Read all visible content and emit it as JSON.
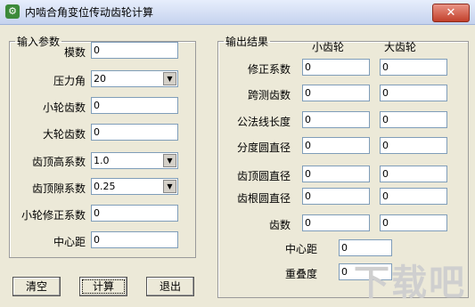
{
  "window": {
    "title": "内啮合角变位传动齿轮计算",
    "close": "✕"
  },
  "input": {
    "legend": "输入参数",
    "rows": [
      {
        "label": "模数",
        "value": "0"
      },
      {
        "label": "压力角",
        "value": "20"
      },
      {
        "label": "小轮齿数",
        "value": "0"
      },
      {
        "label": "大轮齿数",
        "value": "0"
      },
      {
        "label": "齿顶高系数",
        "value": "1.0"
      },
      {
        "label": "齿顶隙系数",
        "value": "0.25"
      },
      {
        "label": "小轮修正系数",
        "value": "0"
      },
      {
        "label": "中心距",
        "value": "0"
      }
    ]
  },
  "output": {
    "legend": "输出结果",
    "col_small": "小齿轮",
    "col_large": "大齿轮",
    "rows": [
      {
        "label": "修正系数",
        "small": "0",
        "large": "0"
      },
      {
        "label": "跨测齿数",
        "small": "0",
        "large": "0"
      },
      {
        "label": "公法线长度",
        "small": "0",
        "large": "0"
      },
      {
        "label": "分度圆直径",
        "small": "0",
        "large": "0"
      },
      {
        "label": "齿顶圆直径",
        "small": "0",
        "large": "0"
      },
      {
        "label": "齿根圆直径",
        "small": "0",
        "large": "0"
      },
      {
        "label": "齿数",
        "small": "0",
        "large": "0"
      }
    ],
    "center_distance": {
      "label": "中心距",
      "value": "0"
    },
    "overlap": {
      "label": "重叠度",
      "value": "0"
    }
  },
  "buttons": {
    "clear": "清空",
    "calc": "计算",
    "exit": "退出"
  },
  "watermark": "下载吧"
}
